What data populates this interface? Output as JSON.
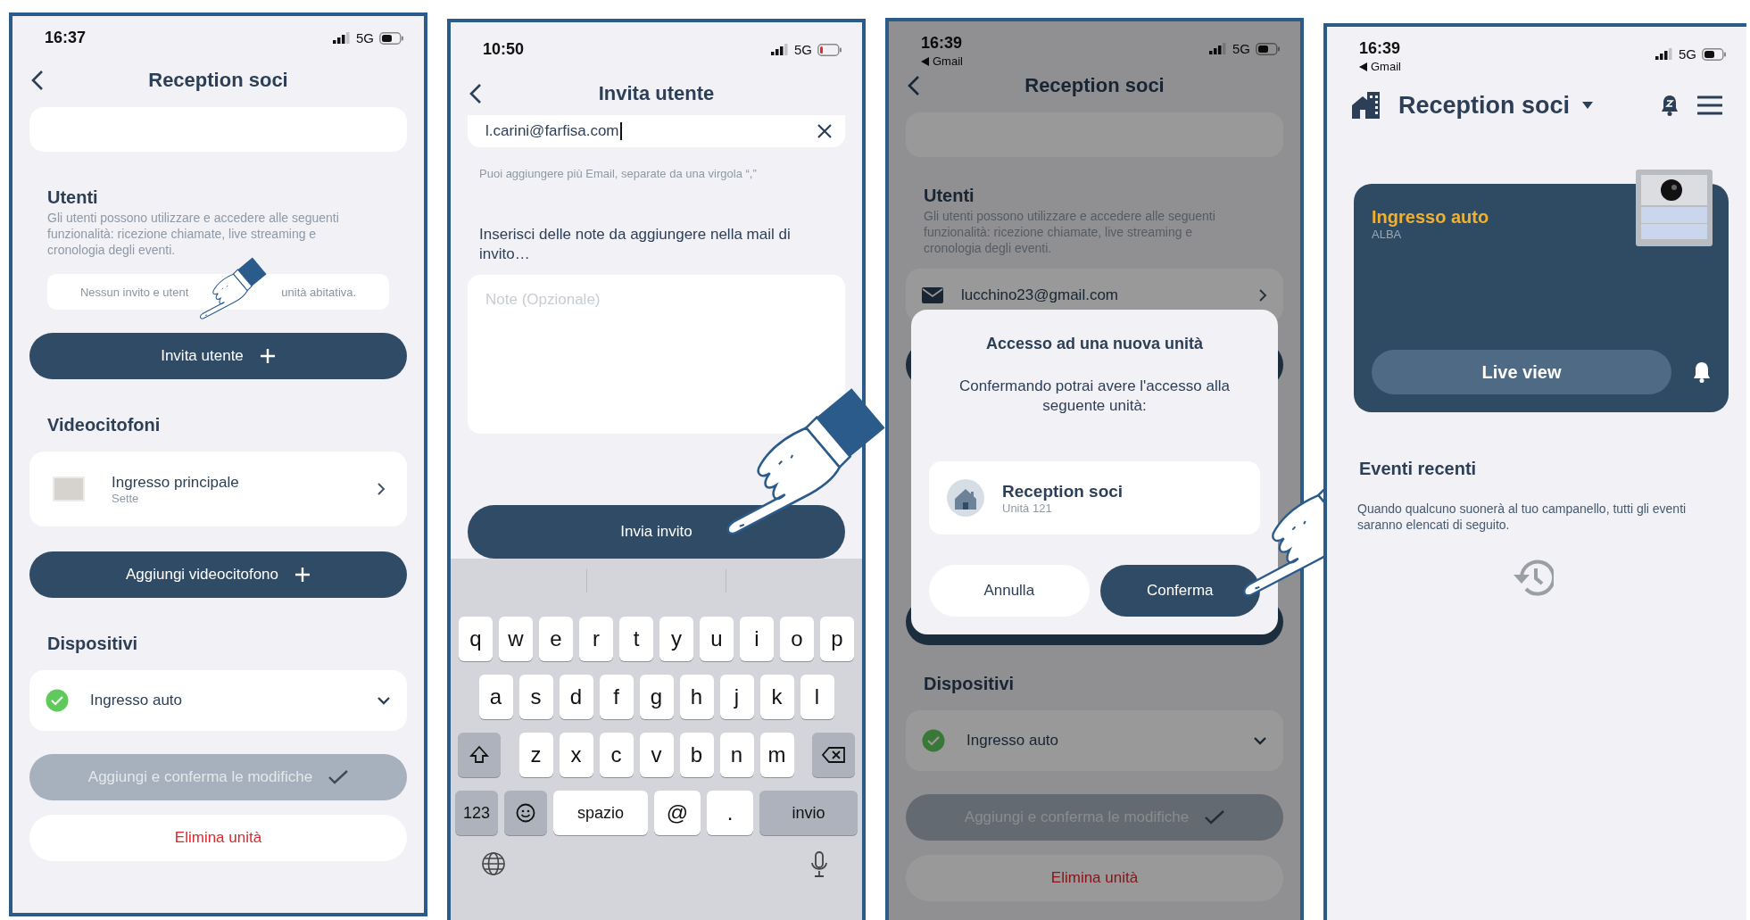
{
  "screens": [
    {
      "kind": "unit",
      "hand_pointer": true,
      "status_bar": {
        "time": "16:37",
        "network": "5G",
        "battery_low": false
      },
      "nav": {
        "title": "Reception soci"
      },
      "blocks": [
        {
          "kind": "blank_card"
        },
        {
          "kind": "section",
          "title": "Utenti",
          "description": "Gli utenti possono utilizzare e accedere alle seguenti funzionalità: ricezione chiamate, live streaming e cronologia degli eventi."
        },
        {
          "kind": "empty_note",
          "fragments": [
            "Nessun invito e utent",
            "unità abitativa."
          ]
        },
        {
          "kind": "add_button",
          "label": "Invita utente"
        },
        {
          "kind": "section",
          "title": "Videocitofoni"
        },
        {
          "kind": "device_card",
          "name": "Ingresso principale",
          "model": "Sette"
        },
        {
          "kind": "add_button",
          "label": "Aggiungi videocitofono"
        },
        {
          "kind": "section",
          "title": "Dispositivi"
        },
        {
          "kind": "device_row",
          "name": "Ingresso auto",
          "online": true,
          "expanded": false
        },
        {
          "kind": "save_button",
          "label": "Aggiungi e conferma le modifiche",
          "disabled": true
        },
        {
          "kind": "delete_button",
          "label": "Elimina unità"
        }
      ]
    },
    {
      "kind": "invite",
      "hand_pointer": true,
      "status_bar": {
        "time": "10:50",
        "network": "5G",
        "battery_low": true
      },
      "nav": {
        "title": "Invita utente"
      },
      "email_field": {
        "value": "l.carini@farfisa.com"
      },
      "hint": "Puoi aggiungere più Email, separate da una virgola “,”",
      "notes_label": "Inserisci delle note da aggiungere nella mail di invito…",
      "notes_field": {
        "placeholder": "Note (Opzionale)"
      },
      "submit": "Invia invito",
      "keyboard": {
        "letter_rows": [
          [
            "q",
            "w",
            "e",
            "r",
            "t",
            "y",
            "u",
            "i",
            "o",
            "p"
          ],
          [
            "a",
            "s",
            "d",
            "f",
            "g",
            "h",
            "j",
            "k",
            "l"
          ],
          [
            "z",
            "x",
            "c",
            "v",
            "b",
            "n",
            "m"
          ]
        ],
        "bottom_keys": [
          {
            "kind": "mode",
            "label": "123"
          },
          {
            "kind": "emoji"
          },
          {
            "kind": "space",
            "label": "spazio"
          },
          {
            "kind": "symbol",
            "label": "@"
          },
          {
            "kind": "symbol",
            "label": "."
          },
          {
            "kind": "return",
            "label": "invio"
          }
        ]
      }
    },
    {
      "kind": "unit",
      "dimmed": true,
      "hand_pointer": true,
      "status_bar": {
        "time": "16:39",
        "back_app": "Gmail",
        "network": "5G",
        "battery_low": false
      },
      "nav": {
        "title": "Reception soci"
      },
      "blocks": [
        {
          "kind": "blank_card"
        },
        {
          "kind": "section",
          "title": "Utenti",
          "description": "Gli utenti possono utilizzare e accedere alle seguenti funzionalità: ricezione chiamate, live streaming e cronologia degli eventi."
        },
        {
          "kind": "user_row",
          "email": "lucchino23@gmail.com"
        },
        {
          "kind": "covered_button"
        },
        {
          "kind": "covered_button"
        },
        {
          "kind": "section",
          "title": "Dispositivi"
        },
        {
          "kind": "device_row",
          "name": "Ingresso auto",
          "online": true,
          "expanded": false
        },
        {
          "kind": "save_button",
          "label": "Aggiungi e conferma le modifiche",
          "disabled": true
        },
        {
          "kind": "delete_button",
          "label": "Elimina unità"
        }
      ],
      "dialog": {
        "title": "Accesso ad una nuova unità",
        "message": "Confermando potrai avere l'accesso alla seguente unità:",
        "unit": {
          "name": "Reception soci",
          "number": "Unità 121"
        },
        "buttons": [
          {
            "label": "Annulla",
            "primary": false
          },
          {
            "label": "Conferma",
            "primary": true
          }
        ]
      }
    },
    {
      "kind": "home",
      "status_bar": {
        "time": "16:39",
        "back_app": "Gmail",
        "network": "5G",
        "battery_low": false
      },
      "header": {
        "title": "Reception soci"
      },
      "device": {
        "name": "Ingresso auto",
        "model": "ALBA",
        "action": "Live view"
      },
      "events": {
        "title": "Eventi recenti",
        "description": "Quando qualcuno suonerà al tuo campanello, tutti gli eventi saranno elencati di seguito."
      }
    }
  ]
}
